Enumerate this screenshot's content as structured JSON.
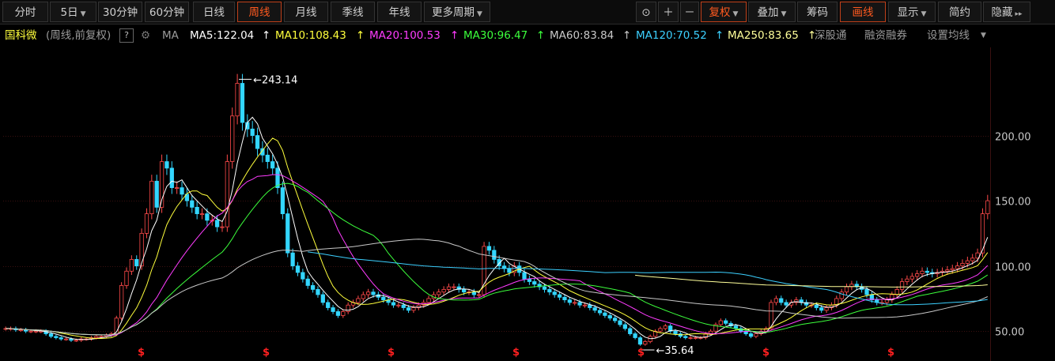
{
  "toolbar": {
    "periods": [
      "分时",
      "5日",
      "30分钟",
      "60分钟",
      "日线",
      "周线",
      "月线",
      "季线",
      "年线",
      "更多周期"
    ],
    "active_period": "周线",
    "right_buttons": [
      "复权",
      "叠加",
      "筹码",
      "画线",
      "显示",
      "简约",
      "隐藏"
    ],
    "icons": [
      "unlock-icon",
      "zoom-in-icon",
      "zoom-out-icon",
      "expand-right-icon"
    ]
  },
  "infobar": {
    "stock_name": "国科微",
    "subtitle": "(周线,前复权)",
    "help": "?",
    "ma_label": "MA",
    "ma5": "MA5:122.04",
    "ma10": "MA10:108.43",
    "ma20": "MA20:100.53",
    "ma30": "MA30:96.47",
    "ma60": "MA60:83.84",
    "ma120": "MA120:70.52",
    "ma250": "MA250:83.65",
    "up_arrow": "↑",
    "link_shenzhen": "深股通",
    "link_margin": "融资融券",
    "link_ma_settings": "设置均线"
  },
  "colors": {
    "up": "#ff4a4a",
    "down": "#33d6ff",
    "ma5": "#ffffff",
    "ma10": "#ffff3c",
    "ma20": "#ff3cff",
    "ma30": "#3cff3c",
    "ma60": "#c8c8c8",
    "ma120": "#3cd0ff",
    "ma250": "#ffff9a",
    "accent": "#ff5a1f"
  },
  "chart_data": {
    "type": "candlestick",
    "title": "国科微 (周线,前复权)",
    "ylim": [
      35,
      250
    ],
    "yticks": [
      50,
      100,
      150,
      200
    ],
    "ytick_labels": [
      "50.00",
      "100.00",
      "150.00",
      "200.00"
    ],
    "annotations": {
      "high": {
        "label": "243.14",
        "value": 243.14
      },
      "low": {
        "label": "35.64",
        "value": 35.64
      }
    },
    "marker_glyph": "$",
    "marker_count": 7,
    "series": [
      {
        "name": "close",
        "values": [
          52,
          52,
          51,
          51,
          50,
          50,
          50,
          50,
          48,
          46,
          45,
          44,
          44,
          43,
          43,
          44,
          44,
          45,
          46,
          46,
          47,
          48,
          60,
          85,
          96,
          105,
          100,
          125,
          140,
          165,
          145,
          180,
          175,
          160,
          160,
          155,
          150,
          145,
          140,
          140,
          135,
          135,
          130,
          130,
          180,
          215,
          240,
          210,
          205,
          200,
          190,
          185,
          180,
          175,
          160,
          140,
          110,
          100,
          95,
          90,
          85,
          82,
          78,
          72,
          68,
          65,
          62,
          65,
          70,
          72,
          75,
          78,
          80,
          78,
          76,
          74,
          72,
          70,
          70,
          68,
          66,
          68,
          70,
          72,
          75,
          78,
          80,
          82,
          84,
          84,
          82,
          80,
          80,
          78,
          78,
          115,
          112,
          105,
          100,
          98,
          95,
          100,
          95,
          90,
          88,
          86,
          84,
          82,
          80,
          78,
          76,
          74,
          72,
          72,
          70,
          70,
          68,
          66,
          64,
          62,
          60,
          58,
          55,
          52,
          48,
          45,
          40,
          42,
          46,
          50,
          52,
          54,
          50,
          48,
          46,
          45,
          45,
          45,
          45,
          48,
          50,
          55,
          58,
          56,
          54,
          52,
          50,
          48,
          46,
          48,
          50,
          52,
          72,
          75,
          72,
          70,
          72,
          74,
          72,
          70,
          70,
          68,
          66,
          68,
          70,
          75,
          80,
          84,
          86,
          84,
          82,
          78,
          74,
          72,
          72,
          74,
          78,
          82,
          88,
          90,
          92,
          94,
          96,
          95,
          94,
          95,
          96,
          97,
          98,
          100,
          102,
          104,
          106,
          110,
          140,
          150
        ]
      }
    ],
    "moving_averages": [
      "MA5",
      "MA10",
      "MA20",
      "MA30",
      "MA60",
      "MA120",
      "MA250"
    ]
  }
}
